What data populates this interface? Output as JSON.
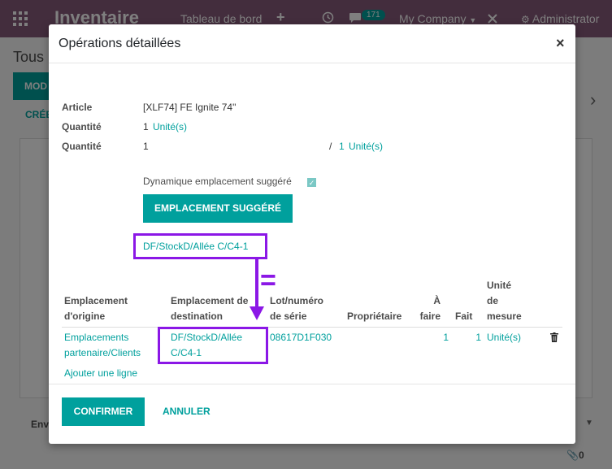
{
  "app": {
    "brand": "Inventaire",
    "nav_dashboard": "Tableau de bord",
    "plus": "+",
    "messages_count": "171",
    "company": "My Company",
    "user": "Administrator"
  },
  "background": {
    "page_title": "Tous",
    "edit_button": "MOD",
    "create_link": "CRÉE",
    "env_label": "Env",
    "attachments": "0"
  },
  "modal": {
    "title": "Opérations détaillées",
    "close": "×",
    "article_label": "Article",
    "article_value": "[XLF74] FE Ignite 74\"",
    "qty_label_1": "Quantité",
    "qty_value_1": "1",
    "qty_unit_1": "Unité(s)",
    "qty_label_2": "Quantité",
    "qty_value_2": "1",
    "qty_sep": "/",
    "qty_total": "1",
    "qty_unit_2": "Unité(s)",
    "dynamic_label": "Dynamique emplacement suggéré",
    "dynamic_checked": true,
    "suggest_button": "EMPLACEMENT SUGGÉRÉ",
    "suggested_location": "DF/StockD/Allée C/C4-1",
    "equals_sign": "=",
    "table": {
      "headers": {
        "origin": [
          "Emplacement",
          "d'origine"
        ],
        "destination": [
          "Emplacement de",
          "destination"
        ],
        "lot": [
          "Lot/numéro",
          "de série"
        ],
        "owner": [
          "Propriétaire"
        ],
        "todo": [
          "À",
          "faire"
        ],
        "done": [
          "Fait"
        ],
        "uom": [
          "Unité",
          "de",
          "mesure"
        ]
      },
      "rows": [
        {
          "origin": [
            "Emplacements",
            "partenaire/Clients"
          ],
          "destination": [
            "DF/StockD/Allée",
            "C/C4-1"
          ],
          "lot": "08617D1F030",
          "owner": "",
          "todo": "1",
          "done": "1",
          "uom": "Unité(s)"
        }
      ],
      "add_line": "Ajouter une ligne"
    },
    "confirm_button": "CONFIRMER",
    "cancel_button": "ANNULER"
  },
  "colors": {
    "accent": "#00a09d",
    "navbar": "#875a7b",
    "highlight": "#8b17e6"
  }
}
